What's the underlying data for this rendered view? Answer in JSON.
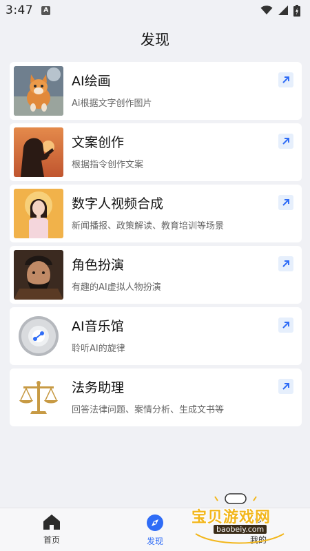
{
  "status_bar": {
    "time": "3:47"
  },
  "header": {
    "title": "发现"
  },
  "features": [
    {
      "title": "AI绘画",
      "desc": "Ai根据文字创作图片"
    },
    {
      "title": "文案创作",
      "desc": "根据指令创作文案"
    },
    {
      "title": "数字人视频合成",
      "desc": "新闻播报、政策解读、教育培训等场景"
    },
    {
      "title": "角色扮演",
      "desc": "有趣的AI虚拟人物扮演"
    },
    {
      "title": "AI音乐馆",
      "desc": "聆听AI的旋律"
    },
    {
      "title": "法务助理",
      "desc": "回答法律问题、案情分析、生成文书等"
    }
  ],
  "bottom_nav": {
    "items": [
      {
        "label": "首页",
        "icon": "home-icon"
      },
      {
        "label": "发现",
        "icon": "compass-icon",
        "active": true
      },
      {
        "label": "我的",
        "icon": "user-icon"
      }
    ]
  },
  "watermark": {
    "text": "宝贝游戏网",
    "url": "baobeiy.com"
  },
  "colors": {
    "accent": "#2f6cf6",
    "background": "#f0f1f5",
    "card": "#ffffff"
  }
}
